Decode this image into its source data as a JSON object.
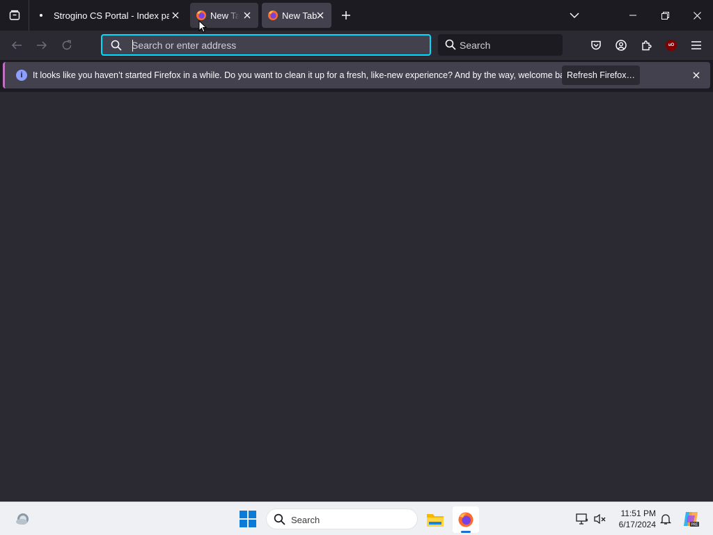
{
  "tabs": [
    {
      "label": "Strogino CS Portal - Index page",
      "active": false
    },
    {
      "label": "New Tab",
      "active": false
    },
    {
      "label": "New Tab",
      "active": true
    }
  ],
  "urlbar": {
    "placeholder": "Search or enter address",
    "value": ""
  },
  "searchbar": {
    "placeholder": "Search"
  },
  "notification": {
    "message": "It looks like you haven’t started Firefox in a while. Do you want to clean it up for a fresh, like-new experience? And by the way, welcome back!",
    "button_label": "Refresh Firefox…"
  },
  "taskbar": {
    "search_placeholder": "Search",
    "time": "11:51 PM",
    "date": "6/17/2024"
  },
  "colors": {
    "toolbar": "#2b2a33",
    "tabstrip": "#1c1b22",
    "focus_ring": "#00ddff",
    "accent": "#1a6fcf"
  },
  "icons": [
    "firefox-view-icon",
    "firefox-icon",
    "close-icon",
    "plus-icon",
    "chevron-down-icon",
    "minimize-icon",
    "maximize-icon",
    "back-arrow-icon",
    "forward-arrow-icon",
    "reload-icon",
    "search-icon",
    "pocket-icon",
    "account-icon",
    "extensions-icon",
    "ublock-icon",
    "hamburger-menu-icon",
    "info-icon",
    "windows-start-icon",
    "file-explorer-icon",
    "notification-bell-icon",
    "copilot-icon",
    "weather-icon"
  ]
}
